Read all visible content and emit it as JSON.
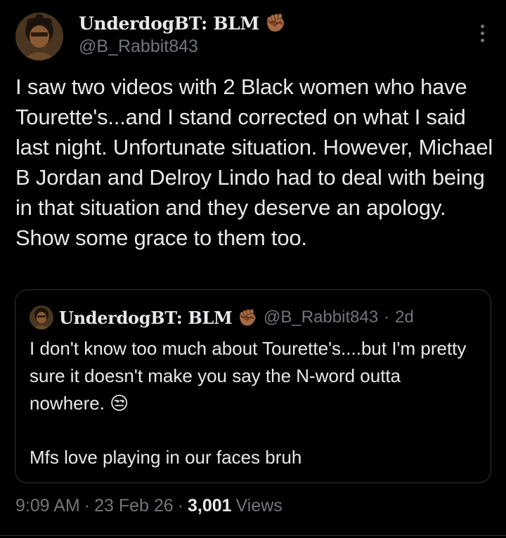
{
  "author": {
    "display_name": "UnderdogBT: BLM",
    "badge_emoji": "✊🏾",
    "handle": "@B_Rabbit843"
  },
  "tweet": {
    "text": "I saw two videos with 2 Black women who have Tourette's...and I stand corrected on what I said last night. Unfortunate situation. However, Michael B Jordan and Delroy Lindo had to deal with being in that situation and they deserve an apology. Show some grace to them too."
  },
  "quoted_tweet": {
    "display_name": "UnderdogBT: BLM",
    "badge_emoji": "✊🏾",
    "handle": "@B_Rabbit843",
    "separator": "·",
    "time": "2d",
    "line1": "I don't know too much about Tourette's....but I'm pretty sure it doesn't make you say the N-word outta nowhere. 😒",
    "line2": "Mfs love playing in our faces bruh"
  },
  "meta": {
    "time": "9:09 AM",
    "sep1": "·",
    "date": "23 Feb 26",
    "sep2": "·",
    "views_count": "3,001",
    "views_label": "Views"
  },
  "colors": {
    "background": "#000000",
    "text": "#e7e9ea",
    "muted": "#71767b",
    "border": "#2f3336"
  }
}
